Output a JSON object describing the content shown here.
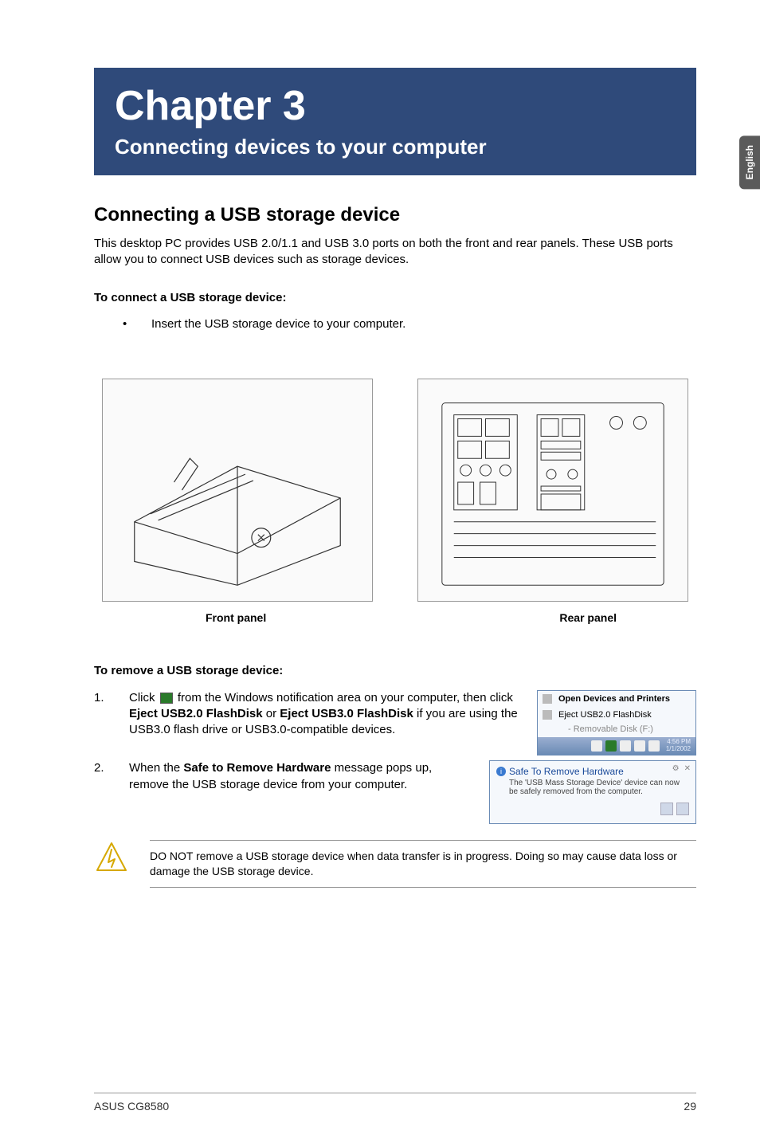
{
  "side_tab": "English",
  "chapter": {
    "title": "Chapter 3",
    "subtitle": "Connecting devices to your computer"
  },
  "section": {
    "title": "Connecting a USB storage device",
    "intro": "This desktop PC provides USB 2.0/1.1 and USB 3.0 ports on both the front and rear panels. These USB ports allow you to connect USB devices such as storage devices."
  },
  "connect": {
    "heading": "To connect a USB storage device:",
    "bullet": "Insert the USB storage device to your computer."
  },
  "figures": {
    "front_caption": "Front panel",
    "rear_caption": "Rear panel"
  },
  "remove": {
    "heading": "To remove a USB storage device:",
    "step1": {
      "num": "1.",
      "pre": "Click ",
      "mid1": " from the Windows notification area on your computer, then click ",
      "bold1": "Eject USB2.0 FlashDisk",
      "or": " or ",
      "bold2": "Eject USB3.0 FlashDisk",
      "post": " if you are using the USB3.0 flash drive or USB3.0-compatible devices."
    },
    "step2": {
      "num": "2.",
      "pre": "When the ",
      "bold": "Safe to Remove Hardware",
      "post": " message pops up, remove the USB storage device from your computer."
    }
  },
  "menu": {
    "open": "Open Devices and Printers",
    "eject": "Eject USB2.0 FlashDisk",
    "removable": "Removable Disk (F:)",
    "time": "4:56 PM",
    "date": "1/1/2002"
  },
  "balloon": {
    "title": "Safe To Remove Hardware",
    "body": "The 'USB Mass Storage Device' device can now be safely removed from the computer."
  },
  "warning": "DO NOT remove a USB storage device when data transfer is in progress. Doing so may cause data loss or damage the USB storage device.",
  "footer": {
    "left": "ASUS CG8580",
    "right": "29"
  }
}
